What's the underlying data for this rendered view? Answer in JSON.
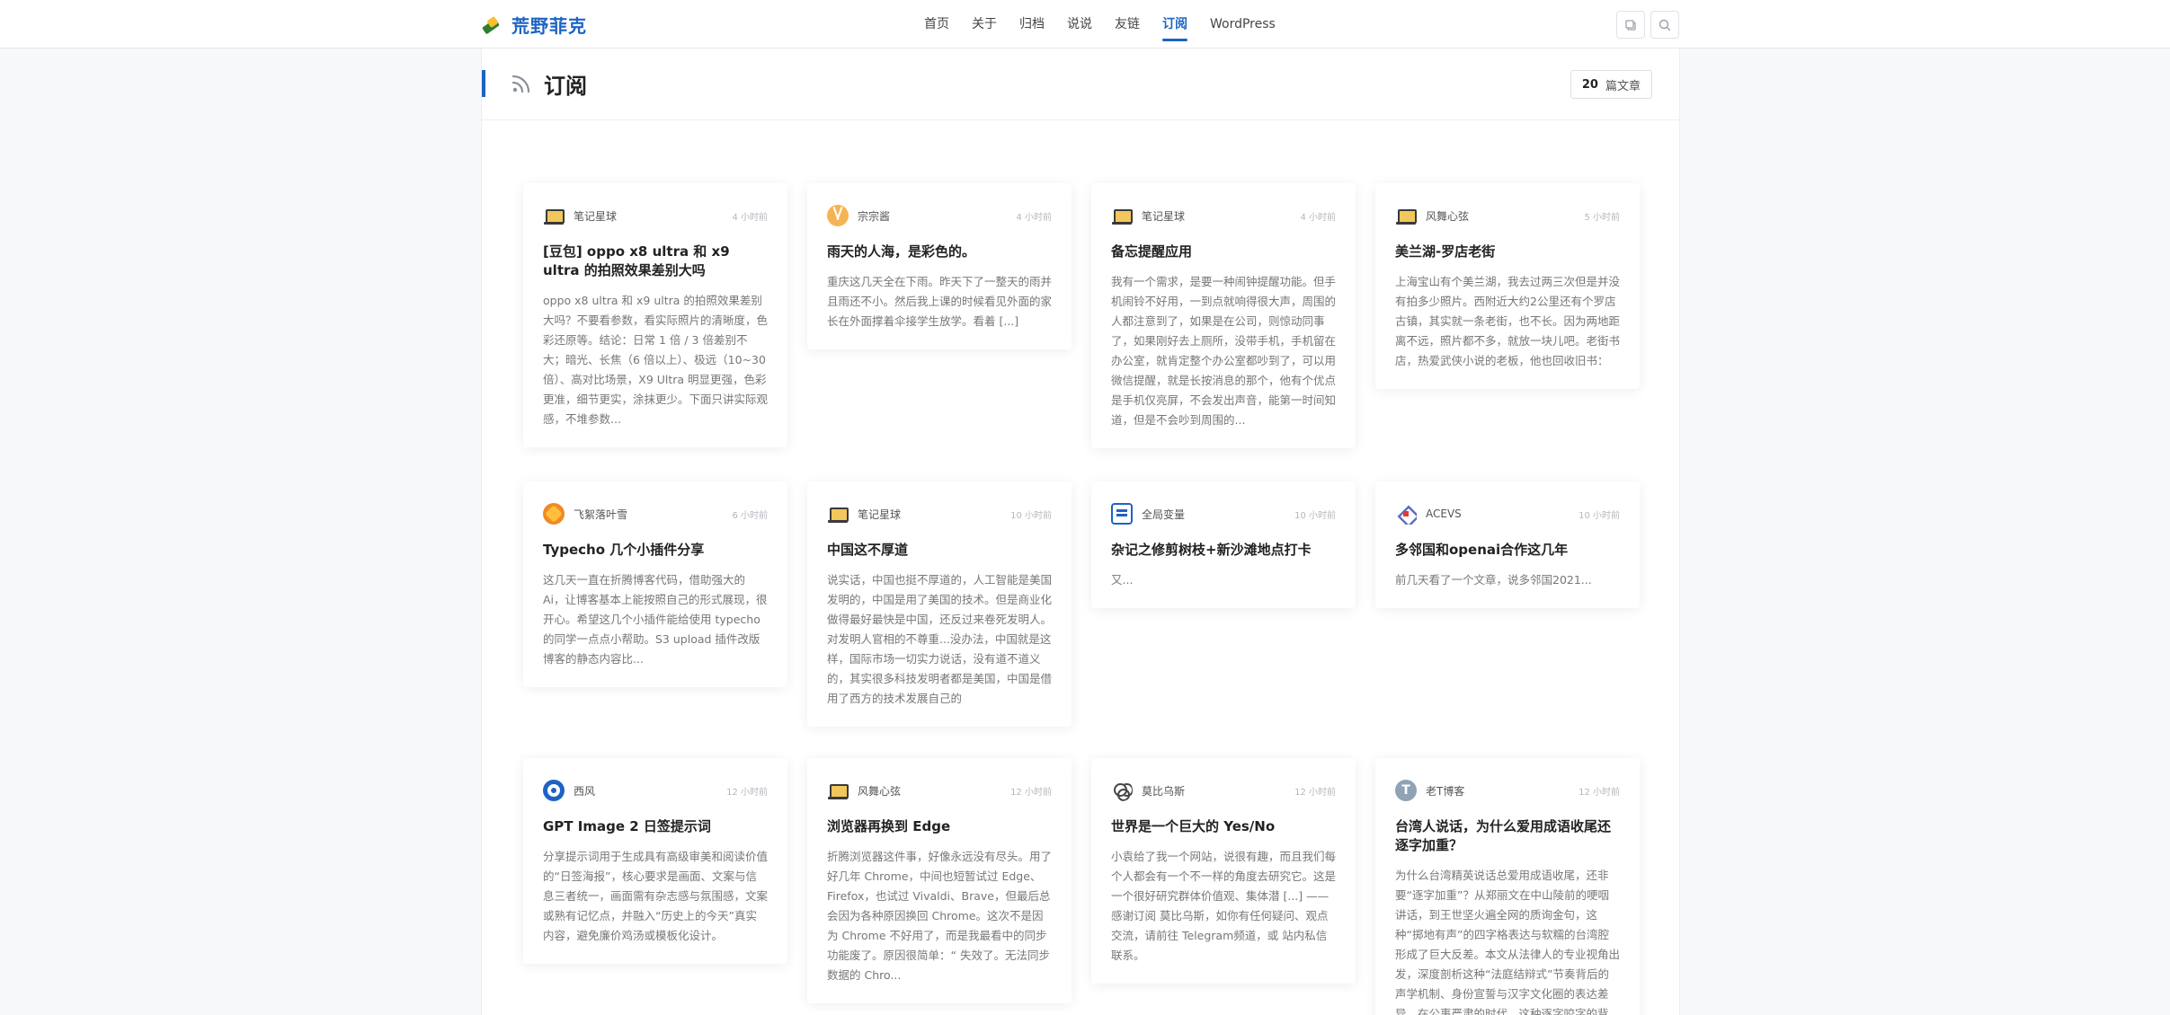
{
  "header": {
    "logo_text": "荒野菲克",
    "nav": [
      {
        "label": "首页",
        "active": false
      },
      {
        "label": "关于",
        "active": false
      },
      {
        "label": "归档",
        "active": false
      },
      {
        "label": "说说",
        "active": false
      },
      {
        "label": "友链",
        "active": false
      },
      {
        "label": "订阅",
        "active": true
      },
      {
        "label": "WordPress",
        "active": false
      }
    ],
    "icons": [
      "copy-icon",
      "search-icon"
    ],
    "accent_color": "#1d63c4"
  },
  "page": {
    "title": "订阅",
    "title_icon": "rss-icon",
    "count": "20",
    "count_label": "篇文章"
  },
  "cards": [
    {
      "avatar": "laptop-avatar",
      "author": "笔记星球",
      "time": "4 小时前",
      "title": "[豆包] oppo x8 ultra 和 x9 ultra 的拍照效果差别大吗",
      "excerpt": "oppo x8 ultra 和 x9 ultra 的拍照效果差别大吗？不要看参数，看实际照片的清晰度，色彩还原等。结论：日常 1 倍 / 3 倍差别不大；暗光、长焦（6 倍以上）、极远（10~30 倍）、高对比场景，X9 Ultra 明显更强，色彩更准，细节更实，涂抹更少。下面只讲实际观感，不堆参数..."
    },
    {
      "avatar": "orange-avatar",
      "author": "宗宗酱",
      "time": "4 小时前",
      "title": "雨天的人海，是彩色的。",
      "excerpt": "重庆这几天全在下雨。昨天下了一整天的雨并且雨还不小。然后我上课的时候看见外面的家长在外面撑着伞接学生放学。看着 [...]"
    },
    {
      "avatar": "laptop-avatar",
      "author": "笔记星球",
      "time": "4 小时前",
      "title": "备忘提醒应用",
      "excerpt": "我有一个需求，是要一种闹钟提醒功能。但手机闹铃不好用，一到点就响得很大声，周围的人都注意到了，如果是在公司，则惊动同事了，如果刚好去上厕所，没带手机，手机留在办公室，就肯定整个办公室都吵到了，可以用微信提醒，就是长按消息的那个，他有个优点是手机仅亮屏，不会发出声音，能第一时间知道，但是不会吵到周围的..."
    },
    {
      "avatar": "laptop-avatar",
      "author": "风舞心弦",
      "time": "5 小时前",
      "title": "美兰湖-罗店老街",
      "excerpt": "上海宝山有个美兰湖，我去过两三次但是并没有拍多少照片。西附近大约2公里还有个罗店古镇，其实就一条老街，也不长。因为两地距离不远，照片都不多，就放一块儿吧。老街书店，热爱武侠小说的老板，他也回收旧书："
    },
    {
      "avatar": "leaf-avatar",
      "author": "飞絮落叶雪",
      "time": "6 小时前",
      "title": "Typecho 几个小插件分享",
      "excerpt": "这几天一直在折腾博客代码，借助强大的 Ai，让博客基本上能按照自己的形式展现，很开心。希望这几个小插件能给使用 typecho 的同学一点点小帮助。S3 upload 插件改版博客的静态内容比..."
    },
    {
      "avatar": "laptop-avatar",
      "author": "笔记星球",
      "time": "10 小时前",
      "title": "中国这不厚道",
      "excerpt": "说实话，中国也挺不厚道的，人工智能是美国发明的，中国是用了美国的技术。但是商业化做得最好最快是中国，还反过来卷死发明人。对发明人官相的不尊重...没办法，中国就是这样，国际市场一切实力说话，没有道不道义的，其实很多科技发明者都是美国，中国是借用了西方的技术发展自己的"
    },
    {
      "avatar": "square-avatar",
      "author": "全局变量",
      "time": "10 小时前",
      "title": "杂记之修剪树枝+新沙滩地点打卡",
      "excerpt": "又..."
    },
    {
      "avatar": "cube-avatar",
      "author": "ACEVS",
      "time": "10 小时前",
      "title": "多邻国和openai合作这几年",
      "excerpt": "前几天看了一个文章，说多邻国2021..."
    },
    {
      "avatar": "ring-avatar",
      "author": "西风",
      "time": "12 小时前",
      "title": "GPT Image 2 日签提示词",
      "excerpt": "分享提示词用于生成具有高级审美和阅读价值的“日签海报”，核心要求是画面、文案与信息三者统一，画面需有杂志感与氛围感，文案或熟有记忆点，并融入“历史上的今天”真实内容，避免廉价鸡汤或模板化设计。"
    },
    {
      "avatar": "laptop-avatar",
      "author": "风舞心弦",
      "time": "12 小时前",
      "title": "浏览器再换到 Edge",
      "excerpt": "折腾浏览器这件事，好像永远没有尽头。用了好几年 Chrome，中间也短暂试过 Edge、Firefox，也试过 Vivaldi、Brave，但最后总会因为各种原因换回 Chrome。这次不是因为 Chrome 不好用了，而是我最看中的同步功能废了。原因很简单：“ 失效了。无法同步数据的 Chro..."
    },
    {
      "avatar": "knot-avatar",
      "author": "莫比乌斯",
      "time": "12 小时前",
      "title": "世界是一个巨大的 Yes/No",
      "excerpt": "小袁给了我一个网站，说很有趣，而且我们每个人都会有一个不一样的角度去研究它。这是一个很好研究群体价值观、集体潜 [...] —— 感谢订阅 莫比乌斯，如你有任何疑问、观点交流，请前往 Telegram频道，或 站内私信 联系。"
    },
    {
      "avatar": "t-avatar",
      "author": "老T博客",
      "time": "12 小时前",
      "title": "台湾人说话，为什么爱用成语收尾还逐字加重？",
      "excerpt": "为什么台湾精英说话总爱用成语收尾，还非要“逐字加重”？从郑丽文在中山陵前的哽咽讲话，到王世坚火遍全网的质询金句，这种“掷地有声”的四字格表达与软糯的台湾腔形成了巨大反差。本文从法律人的专业视角出发，深度剖析这种“法庭结辩式”节奏背后的声学机制、身份宣誓与汉字文化圈的表达差异。在公事严肃的时代，这种逐字咬字的背..."
    }
  ]
}
